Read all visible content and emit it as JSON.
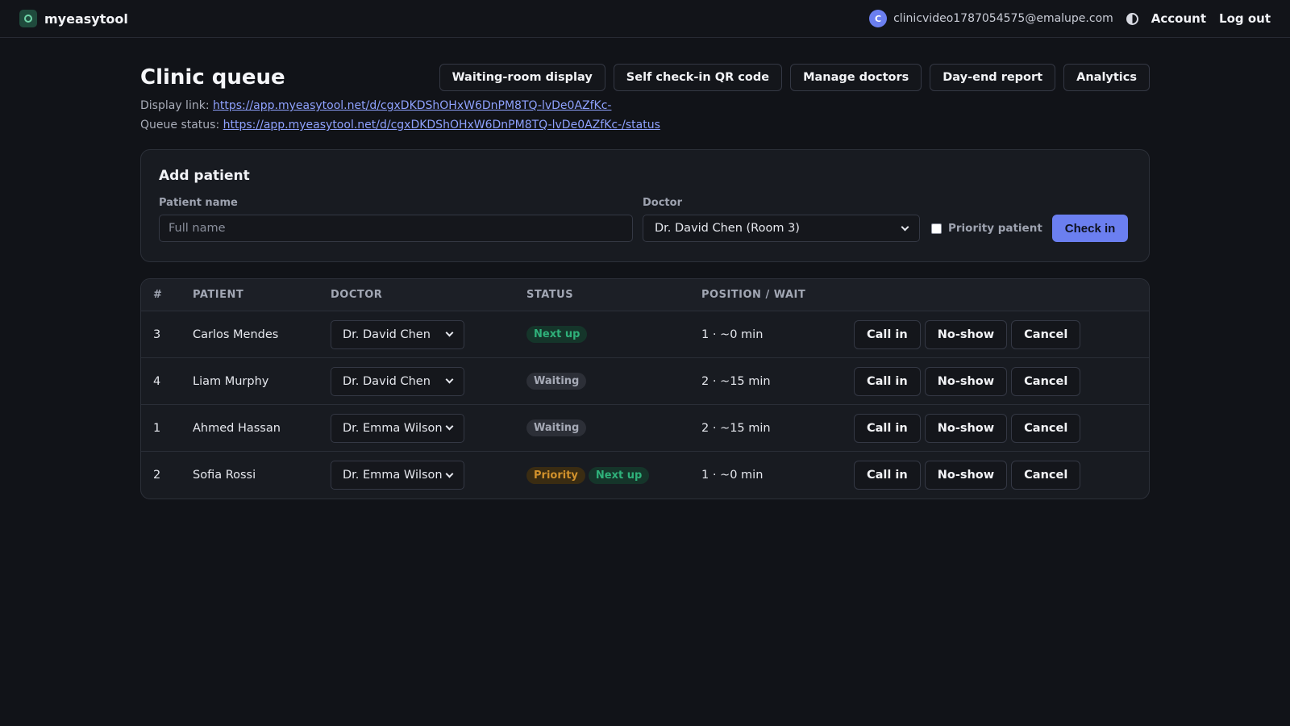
{
  "app": {
    "name": "myeasytool"
  },
  "user": {
    "initial": "C",
    "email": "clinicvideo1787054575@emalupe.com"
  },
  "nav": {
    "account": "Account",
    "logout": "Log out"
  },
  "page": {
    "title": "Clinic queue",
    "actions": [
      "Waiting-room display",
      "Self check-in QR code",
      "Manage doctors",
      "Day-end report",
      "Analytics"
    ],
    "display_link_label": "Display link:",
    "display_link_url": "https://app.myeasytool.net/d/cgxDKDShOHxW6DnPM8TQ-lvDe0AZfKc-",
    "status_link_label": "Queue status:",
    "status_link_url": "https://app.myeasytool.net/d/cgxDKDShOHxW6DnPM8TQ-lvDe0AZfKc-/status"
  },
  "add_patient": {
    "title": "Add patient",
    "name_label": "Patient name",
    "name_placeholder": "Full name",
    "name_value": "",
    "doctor_label": "Doctor",
    "doctor_selected": "Dr. David Chen (Room 3)",
    "priority_label": "Priority patient",
    "priority_checked": false,
    "submit_label": "Check in"
  },
  "table": {
    "headers": {
      "num": "#",
      "patient": "PATIENT",
      "doctor": "DOCTOR",
      "status": "STATUS",
      "position": "POSITION / WAIT"
    },
    "action_labels": {
      "call": "Call in",
      "noshow": "No-show",
      "cancel": "Cancel"
    },
    "rows": [
      {
        "num": "3",
        "patient": "Carlos Mendes",
        "doctor": "Dr. David Chen",
        "status": [
          {
            "label": "Next up",
            "kind": "next"
          }
        ],
        "position": "1 · ~0 min"
      },
      {
        "num": "4",
        "patient": "Liam Murphy",
        "doctor": "Dr. David Chen",
        "status": [
          {
            "label": "Waiting",
            "kind": "wait"
          }
        ],
        "position": "2 · ~15 min"
      },
      {
        "num": "1",
        "patient": "Ahmed Hassan",
        "doctor": "Dr. Emma Wilson",
        "status": [
          {
            "label": "Waiting",
            "kind": "wait"
          }
        ],
        "position": "2 · ~15 min"
      },
      {
        "num": "2",
        "patient": "Sofia Rossi",
        "doctor": "Dr. Emma Wilson",
        "status": [
          {
            "label": "Priority",
            "kind": "prio"
          },
          {
            "label": "Next up",
            "kind": "next"
          }
        ],
        "position": "1 · ~0 min"
      }
    ]
  },
  "colors": {
    "accent": "#6b7ff0",
    "next": "#2fb17a",
    "priority": "#d2922c",
    "background": "#111318"
  }
}
